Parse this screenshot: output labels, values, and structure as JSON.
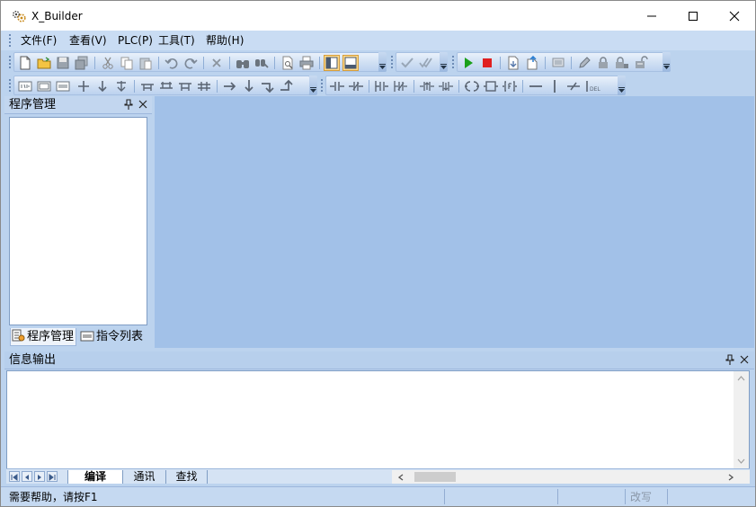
{
  "window": {
    "title": "X_Builder",
    "icon": "gear-app-icon",
    "controls": [
      "minimize-icon",
      "maximize-icon",
      "close-icon"
    ]
  },
  "menu": [
    {
      "label": "文件(F)"
    },
    {
      "label": "查看(V)"
    },
    {
      "label": "PLC(P)"
    },
    {
      "label": "工具(T)"
    },
    {
      "label": "帮助(H)"
    }
  ],
  "left_panel": {
    "title": "程序管理",
    "tabs": [
      {
        "label": "程序管理",
        "icon": "program-tree-icon"
      },
      {
        "label": "指令列表",
        "icon": "instruction-list-icon"
      }
    ]
  },
  "output_panel": {
    "title": "信息输出",
    "tabs": [
      {
        "label": "编译"
      },
      {
        "label": "通讯"
      },
      {
        "label": "查找"
      }
    ]
  },
  "status": {
    "help_text": "需要帮助，请按F1",
    "mode_text": "改写"
  },
  "colors": {
    "workspace": "#a2c1e8",
    "toolbar": "#bcd3ee",
    "run_green": "#1aa01a",
    "stop_red": "#e02020"
  }
}
